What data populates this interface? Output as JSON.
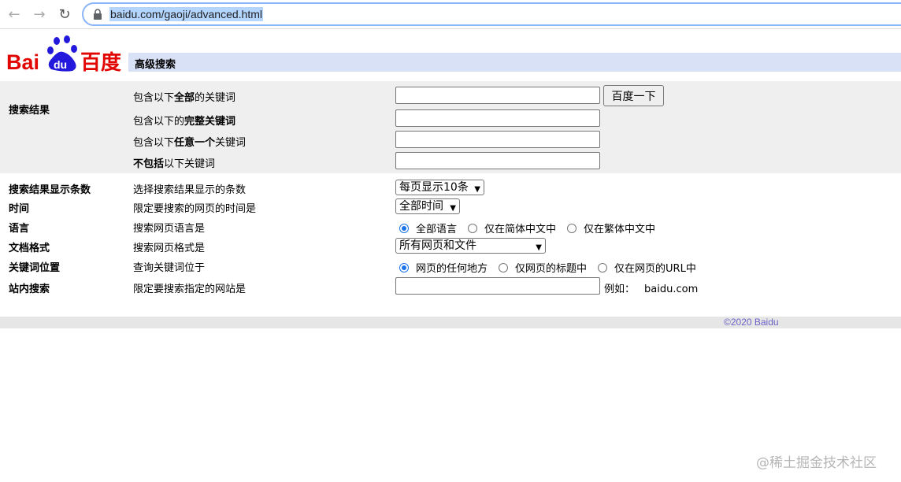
{
  "browser": {
    "url": "baidu.com/gaoji/advanced.html"
  },
  "header": {
    "logo_text": "Bai du 百度",
    "title": "高级搜索"
  },
  "keywords": {
    "section_label": "搜索结果",
    "rows": [
      {
        "prefix": "包含以下",
        "bold": "全部",
        "suffix": "的关键词"
      },
      {
        "prefix": "包含以下的",
        "bold": "完整关键词",
        "suffix": ""
      },
      {
        "prefix": "包含以下",
        "bold": "任意一个",
        "suffix": "关键词"
      },
      {
        "prefix": "",
        "bold": "不包括",
        "suffix": "以下关键词"
      }
    ],
    "search_button": "百度一下"
  },
  "options": {
    "count": {
      "label": "搜索结果显示条数",
      "desc": "选择搜索结果显示的条数",
      "value": "每页显示10条"
    },
    "time": {
      "label": "时间",
      "desc": "限定要搜索的网页的时间是",
      "value": "全部时间"
    },
    "language": {
      "label": "语言",
      "desc": "搜索网页语言是",
      "choices": [
        "全部语言",
        "仅在简体中文中",
        "仅在繁体中文中"
      ]
    },
    "format": {
      "label": "文档格式",
      "desc": "搜索网页格式是",
      "value": "所有网页和文件"
    },
    "position": {
      "label": "关键词位置",
      "desc": "查询关键词位于",
      "choices": [
        "网页的任何地方",
        "仅网页的标题中",
        "仅在网页的URL中"
      ]
    },
    "site": {
      "label": "站内搜索",
      "desc": "限定要搜索指定的网站是",
      "example_label": "例如：",
      "example_value": "baidu.com"
    }
  },
  "footer": {
    "copyright": "©2020 Baidu"
  },
  "watermark": "@稀土掘金技术社区",
  "colors": {
    "title_bar": "#d9e1f7",
    "baidu_red": "#e10602",
    "baidu_blue": "#2319dc",
    "radio_selected": "#1a73e8"
  }
}
